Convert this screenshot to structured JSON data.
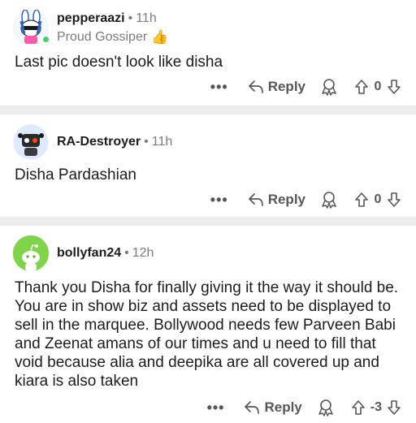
{
  "comments": [
    {
      "username": "pepperaazi",
      "time": "11h",
      "flair": "Proud Gossiper",
      "flair_icon": "thumbs-up-emoji",
      "text": "Last pic doesn't look like disha",
      "reply_label": "Reply",
      "score": "0",
      "online": true
    },
    {
      "username": "RA-Destroyer",
      "time": "11h",
      "text": "Disha Pardashian",
      "reply_label": "Reply",
      "score": "0"
    },
    {
      "username": "bollyfan24",
      "time": "12h",
      "text": "Thank you Disha for finally giving it the way it should be. You are in show biz and assets need to be displayed to sell  in the marquee. Bollywood needs few Parveen Babi and Zeenat amans of our times and u need to fill that void because alia and deepika are all covered up and kiara is also taken",
      "reply_label": "Reply",
      "score": "-3"
    }
  ],
  "icons": {
    "more": "more-horizontal-icon",
    "reply": "reply-arrow-icon",
    "award": "award-icon",
    "upvote": "upvote-arrow-icon",
    "downvote": "downvote-arrow-icon"
  },
  "colors": {
    "separator": "#ececec",
    "online": "#46d160",
    "default_avatar": "#7fd44a"
  }
}
